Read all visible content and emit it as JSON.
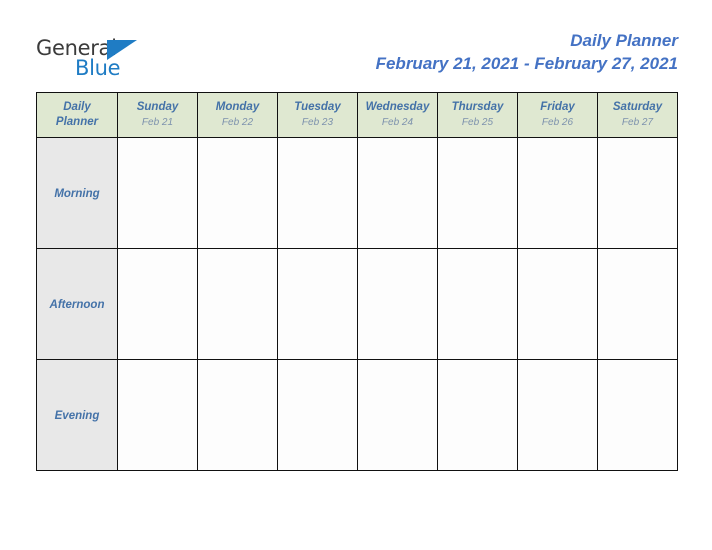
{
  "brand": {
    "line1": "General",
    "line2": "Blue",
    "triangle_color": "#1f7cc4",
    "line1_color": "#3b3b3b"
  },
  "header": {
    "title": "Daily Planner",
    "date_range": "February 21, 2021 - February 27, 2021",
    "title_color": "#4472c4"
  },
  "table": {
    "corner_label_line1": "Daily",
    "corner_label_line2": "Planner",
    "header_background": "#dfe8d1",
    "row_label_background": "#e8e8e8",
    "day_name_color": "#4472a8",
    "day_date_color": "#7d92ad",
    "border_color": "#111111",
    "days": [
      {
        "name": "Sunday",
        "date": "Feb 21"
      },
      {
        "name": "Monday",
        "date": "Feb 22"
      },
      {
        "name": "Tuesday",
        "date": "Feb 23"
      },
      {
        "name": "Wednesday",
        "date": "Feb 24"
      },
      {
        "name": "Thursday",
        "date": "Feb 25"
      },
      {
        "name": "Friday",
        "date": "Feb 26"
      },
      {
        "name": "Saturday",
        "date": "Feb 27"
      }
    ],
    "rows": [
      {
        "label": "Morning",
        "cells": [
          "",
          "",
          "",
          "",
          "",
          "",
          ""
        ]
      },
      {
        "label": "Afternoon",
        "cells": [
          "",
          "",
          "",
          "",
          "",
          "",
          ""
        ]
      },
      {
        "label": "Evening",
        "cells": [
          "",
          "",
          "",
          "",
          "",
          "",
          ""
        ]
      }
    ]
  }
}
